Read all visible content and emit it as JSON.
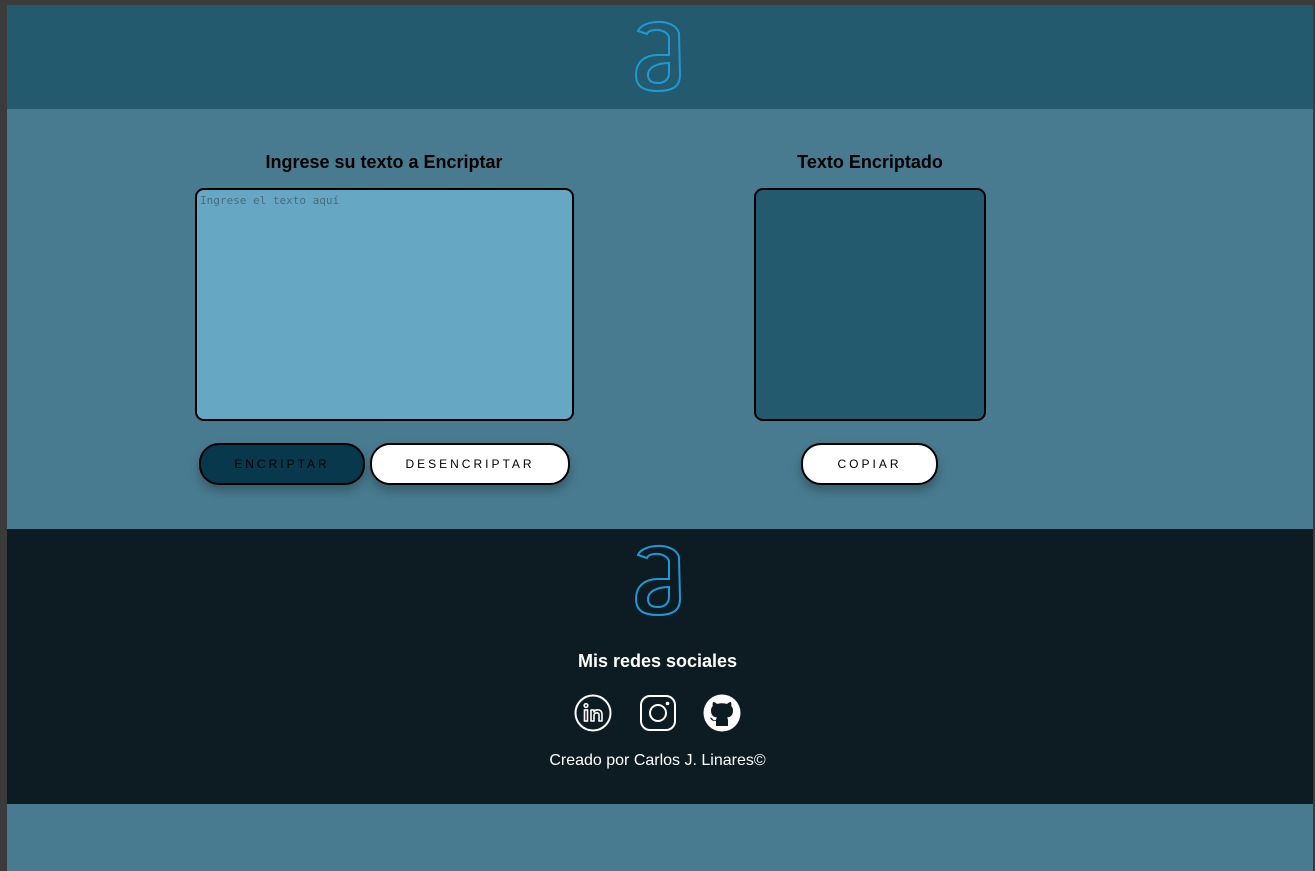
{
  "header": {
    "logo_icon": "letter-a-outline-logo-icon"
  },
  "encrypt_panel": {
    "title": "Ingrese su texto a Encriptar",
    "input_placeholder": "Ingrese el texto aquí",
    "input_value": "",
    "encrypt_label": "ENCRIPTAR",
    "decrypt_label": "DESENCRIPTAR"
  },
  "output_panel": {
    "title": "Texto Encriptado",
    "output_value": "",
    "copy_label": "COPIAR"
  },
  "footer": {
    "logo_icon": "letter-a-outline-logo-icon",
    "social_title": "Mis redes sociales",
    "social_icons": [
      "linkedin-icon",
      "instagram-icon",
      "github-icon"
    ],
    "credit": "Creado por Carlos J. Linares©"
  },
  "colors": {
    "header_bg": "#235a6e",
    "main_bg": "#487b8f",
    "input_bg": "#66a8c3",
    "output_bg": "#235a6e",
    "encrypt_button_bg": "#07384c",
    "footer_bg": "#0d1b23",
    "logo_accent": "#1c9ad6"
  }
}
